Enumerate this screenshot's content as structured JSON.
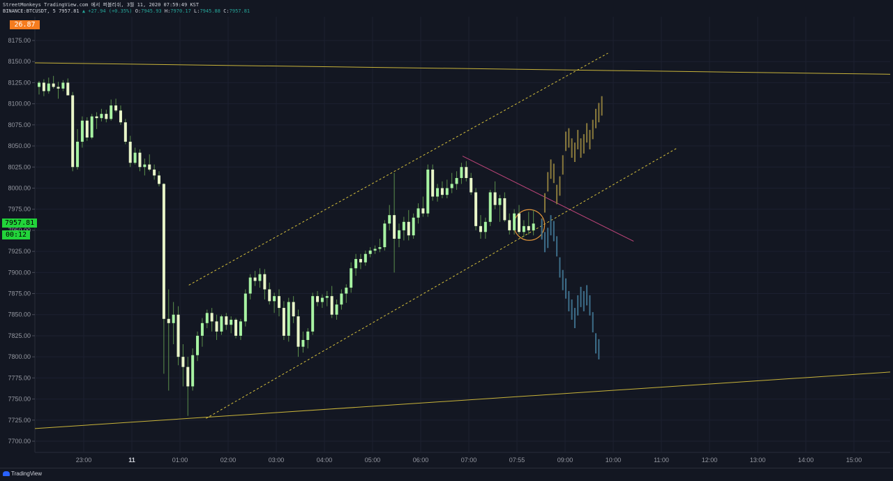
{
  "header": {
    "line1": "StreetMonkeys TradingView.com 에서 퍼블리쉬, 3월 11, 2020 07:59:49 KST",
    "symbol": "BINANCE:BTCUSDT, 5",
    "last": "7957.81",
    "change": "▲ +27.94 (+0.35%)",
    "o_label": "O:",
    "o": "7945.93",
    "h_label": "H:",
    "h": "7970.17",
    "l_label": "L:",
    "l": "7945.88",
    "c_label": "C:",
    "c": "7957.81"
  },
  "indicator_badge": "26.87",
  "price_badge": "7957.81",
  "countdown_badge": "00:12",
  "footer": {
    "brand": "TradingView"
  },
  "colors": {
    "bg": "#131722",
    "up": "#a7f3a2",
    "down": "#e8f5c8",
    "wick": "#5b8f4c",
    "trend": "#c9b43a",
    "channel": "#d8c23c",
    "pink": "#c0457a",
    "circle": "#e0953a",
    "proj_up": "#8a7a3c",
    "proj_down": "#3d6e8a",
    "badge_orange": "#f57c1f",
    "badge_green": "#22d43a"
  },
  "chart_data": {
    "type": "candlestick",
    "interval": "5",
    "ylim": [
      7700,
      8175
    ],
    "y_ticks": [
      "8175.00",
      "8150.00",
      "8125.00",
      "8100.00",
      "8075.00",
      "8050.00",
      "8025.00",
      "8000.00",
      "7975.00",
      "7950.00",
      "7925.00",
      "7900.00",
      "7875.00",
      "7850.00",
      "7825.00",
      "7800.00",
      "7775.00",
      "7750.00",
      "7725.00",
      "7700.00"
    ],
    "x_ticks": [
      "23:00",
      "11",
      "01:00",
      "02:00",
      "03:00",
      "04:00",
      "05:00",
      "06:00",
      "07:00",
      "07:55",
      "09:00",
      "10:00",
      "11:00",
      "12:00",
      "13:00",
      "14:00",
      "15:00"
    ],
    "candles": [
      {
        "o": 8120,
        "h": 8127,
        "l": 8111,
        "c": 8125
      },
      {
        "o": 8125,
        "h": 8129,
        "l": 8109,
        "c": 8115
      },
      {
        "o": 8115,
        "h": 8131,
        "l": 8112,
        "c": 8124
      },
      {
        "o": 8124,
        "h": 8133,
        "l": 8118,
        "c": 8120
      },
      {
        "o": 8120,
        "h": 8126,
        "l": 8106,
        "c": 8118
      },
      {
        "o": 8118,
        "h": 8128,
        "l": 8115,
        "c": 8125
      },
      {
        "o": 8125,
        "h": 8130,
        "l": 8112,
        "c": 8110
      },
      {
        "o": 8110,
        "h": 8114,
        "l": 8020,
        "c": 8025
      },
      {
        "o": 8025,
        "h": 8070,
        "l": 8022,
        "c": 8055
      },
      {
        "o": 8055,
        "h": 8085,
        "l": 8048,
        "c": 8080
      },
      {
        "o": 8080,
        "h": 8084,
        "l": 8056,
        "c": 8060
      },
      {
        "o": 8060,
        "h": 8088,
        "l": 8058,
        "c": 8085
      },
      {
        "o": 8085,
        "h": 8090,
        "l": 8070,
        "c": 8083
      },
      {
        "o": 8083,
        "h": 8094,
        "l": 8079,
        "c": 8088
      },
      {
        "o": 8088,
        "h": 8093,
        "l": 8078,
        "c": 8082
      },
      {
        "o": 8082,
        "h": 8105,
        "l": 8080,
        "c": 8098
      },
      {
        "o": 8098,
        "h": 8106,
        "l": 8090,
        "c": 8092
      },
      {
        "o": 8092,
        "h": 8098,
        "l": 8075,
        "c": 8078
      },
      {
        "o": 8078,
        "h": 8082,
        "l": 8052,
        "c": 8055
      },
      {
        "o": 8055,
        "h": 8062,
        "l": 8025,
        "c": 8030
      },
      {
        "o": 8030,
        "h": 8048,
        "l": 8028,
        "c": 8042
      },
      {
        "o": 8042,
        "h": 8046,
        "l": 8020,
        "c": 8025
      },
      {
        "o": 8025,
        "h": 8035,
        "l": 8015,
        "c": 8028
      },
      {
        "o": 8028,
        "h": 8040,
        "l": 8020,
        "c": 8022
      },
      {
        "o": 8022,
        "h": 8028,
        "l": 8010,
        "c": 8015
      },
      {
        "o": 8015,
        "h": 8020,
        "l": 8002,
        "c": 8005
      },
      {
        "o": 8005,
        "h": 8006,
        "l": 7780,
        "c": 7845
      },
      {
        "o": 7845,
        "h": 7880,
        "l": 7760,
        "c": 7840
      },
      {
        "o": 7840,
        "h": 7865,
        "l": 7815,
        "c": 7850
      },
      {
        "o": 7850,
        "h": 7860,
        "l": 7790,
        "c": 7800
      },
      {
        "o": 7800,
        "h": 7815,
        "l": 7765,
        "c": 7788
      },
      {
        "o": 7788,
        "h": 7800,
        "l": 7730,
        "c": 7765
      },
      {
        "o": 7765,
        "h": 7810,
        "l": 7760,
        "c": 7802
      },
      {
        "o": 7802,
        "h": 7830,
        "l": 7795,
        "c": 7825
      },
      {
        "o": 7825,
        "h": 7846,
        "l": 7812,
        "c": 7840
      },
      {
        "o": 7840,
        "h": 7856,
        "l": 7834,
        "c": 7852
      },
      {
        "o": 7852,
        "h": 7858,
        "l": 7830,
        "c": 7842
      },
      {
        "o": 7842,
        "h": 7850,
        "l": 7820,
        "c": 7830
      },
      {
        "o": 7830,
        "h": 7850,
        "l": 7826,
        "c": 7848
      },
      {
        "o": 7848,
        "h": 7852,
        "l": 7832,
        "c": 7838
      },
      {
        "o": 7838,
        "h": 7848,
        "l": 7828,
        "c": 7844
      },
      {
        "o": 7844,
        "h": 7846,
        "l": 7822,
        "c": 7825
      },
      {
        "o": 7825,
        "h": 7845,
        "l": 7820,
        "c": 7842
      },
      {
        "o": 7842,
        "h": 7880,
        "l": 7836,
        "c": 7875
      },
      {
        "o": 7875,
        "h": 7898,
        "l": 7868,
        "c": 7894
      },
      {
        "o": 7894,
        "h": 7902,
        "l": 7884,
        "c": 7890
      },
      {
        "o": 7890,
        "h": 7905,
        "l": 7882,
        "c": 7898
      },
      {
        "o": 7898,
        "h": 7904,
        "l": 7868,
        "c": 7880
      },
      {
        "o": 7880,
        "h": 7888,
        "l": 7862,
        "c": 7866
      },
      {
        "o": 7866,
        "h": 7876,
        "l": 7852,
        "c": 7872
      },
      {
        "o": 7872,
        "h": 7880,
        "l": 7848,
        "c": 7858
      },
      {
        "o": 7858,
        "h": 7866,
        "l": 7820,
        "c": 7825
      },
      {
        "o": 7825,
        "h": 7870,
        "l": 7818,
        "c": 7865
      },
      {
        "o": 7865,
        "h": 7872,
        "l": 7840,
        "c": 7848
      },
      {
        "o": 7848,
        "h": 7856,
        "l": 7800,
        "c": 7812
      },
      {
        "o": 7812,
        "h": 7830,
        "l": 7805,
        "c": 7820
      },
      {
        "o": 7820,
        "h": 7834,
        "l": 7810,
        "c": 7830
      },
      {
        "o": 7830,
        "h": 7876,
        "l": 7826,
        "c": 7872
      },
      {
        "o": 7872,
        "h": 7878,
        "l": 7860,
        "c": 7865
      },
      {
        "o": 7865,
        "h": 7874,
        "l": 7858,
        "c": 7870
      },
      {
        "o": 7870,
        "h": 7878,
        "l": 7860,
        "c": 7872
      },
      {
        "o": 7872,
        "h": 7884,
        "l": 7846,
        "c": 7850
      },
      {
        "o": 7850,
        "h": 7868,
        "l": 7844,
        "c": 7862
      },
      {
        "o": 7862,
        "h": 7880,
        "l": 7856,
        "c": 7875
      },
      {
        "o": 7875,
        "h": 7886,
        "l": 7864,
        "c": 7882
      },
      {
        "o": 7882,
        "h": 7912,
        "l": 7876,
        "c": 7905
      },
      {
        "o": 7905,
        "h": 7922,
        "l": 7896,
        "c": 7916
      },
      {
        "o": 7916,
        "h": 7922,
        "l": 7904,
        "c": 7912
      },
      {
        "o": 7912,
        "h": 7926,
        "l": 7908,
        "c": 7922
      },
      {
        "o": 7922,
        "h": 7930,
        "l": 7918,
        "c": 7926
      },
      {
        "o": 7926,
        "h": 7932,
        "l": 7922,
        "c": 7928
      },
      {
        "o": 7928,
        "h": 7940,
        "l": 7924,
        "c": 7930
      },
      {
        "o": 7930,
        "h": 7962,
        "l": 7926,
        "c": 7958
      },
      {
        "o": 7958,
        "h": 7980,
        "l": 7950,
        "c": 7968
      },
      {
        "o": 7968,
        "h": 8018,
        "l": 7900,
        "c": 7940
      },
      {
        "o": 7940,
        "h": 7958,
        "l": 7930,
        "c": 7950
      },
      {
        "o": 7950,
        "h": 7966,
        "l": 7938,
        "c": 7960
      },
      {
        "o": 7960,
        "h": 7974,
        "l": 7938,
        "c": 7944
      },
      {
        "o": 7944,
        "h": 7970,
        "l": 7940,
        "c": 7965
      },
      {
        "o": 7965,
        "h": 7982,
        "l": 7958,
        "c": 7976
      },
      {
        "o": 7976,
        "h": 7990,
        "l": 7966,
        "c": 7970
      },
      {
        "o": 7970,
        "h": 8028,
        "l": 7966,
        "c": 8022
      },
      {
        "o": 8022,
        "h": 8028,
        "l": 7985,
        "c": 7990
      },
      {
        "o": 7990,
        "h": 8005,
        "l": 7984,
        "c": 8000
      },
      {
        "o": 8000,
        "h": 8008,
        "l": 7988,
        "c": 7992
      },
      {
        "o": 7992,
        "h": 8010,
        "l": 7988,
        "c": 8000
      },
      {
        "o": 8000,
        "h": 8018,
        "l": 7994,
        "c": 8005
      },
      {
        "o": 8005,
        "h": 8020,
        "l": 7998,
        "c": 8012
      },
      {
        "o": 8012,
        "h": 8030,
        "l": 8005,
        "c": 8025
      },
      {
        "o": 8025,
        "h": 8032,
        "l": 8008,
        "c": 8012
      },
      {
        "o": 8012,
        "h": 8018,
        "l": 7992,
        "c": 7995
      },
      {
        "o": 7995,
        "h": 8000,
        "l": 7950,
        "c": 7955
      },
      {
        "o": 7955,
        "h": 7968,
        "l": 7940,
        "c": 7948
      },
      {
        "o": 7948,
        "h": 7965,
        "l": 7940,
        "c": 7960
      },
      {
        "o": 7960,
        "h": 7998,
        "l": 7955,
        "c": 7995
      },
      {
        "o": 7995,
        "h": 8008,
        "l": 7975,
        "c": 7980
      },
      {
        "o": 7980,
        "h": 7992,
        "l": 7960,
        "c": 7988
      },
      {
        "o": 7988,
        "h": 7995,
        "l": 7960,
        "c": 7962
      },
      {
        "o": 7962,
        "h": 7970,
        "l": 7945,
        "c": 7950
      },
      {
        "o": 7950,
        "h": 7975,
        "l": 7945,
        "c": 7970
      },
      {
        "o": 7970,
        "h": 7980,
        "l": 7945,
        "c": 7948
      },
      {
        "o": 7948,
        "h": 7962,
        "l": 7942,
        "c": 7955
      },
      {
        "o": 7955,
        "h": 7972,
        "l": 7945,
        "c": 7950
      },
      {
        "o": 7950,
        "h": 7974,
        "l": 7944,
        "c": 7958
      }
    ],
    "projection_up": [
      7955,
      7985,
      8010,
      8025,
      8020,
      7995,
      8005,
      8030,
      8058,
      8062,
      8050,
      8045,
      8060,
      8050,
      8055,
      8068,
      8060,
      8072,
      8085,
      8092,
      8100
    ],
    "projection_down": [
      7950,
      7935,
      7940,
      7955,
      7948,
      7930,
      7905,
      7890,
      7880,
      7865,
      7855,
      7845,
      7860,
      7870,
      7865,
      7872,
      7860,
      7840,
      7815,
      7808
    ],
    "drawings": {
      "upper_trendline": [
        [
          8148.5,
          0
        ],
        [
          8135,
          1
        ]
      ],
      "lower_trendline": [
        [
          7715,
          0
        ],
        [
          7782,
          1
        ]
      ],
      "channel_upper": [
        [
          7885,
          0.18
        ],
        [
          8160,
          0.67
        ]
      ],
      "channel_lower": [
        [
          7727,
          0.2
        ],
        [
          8047,
          0.75
        ]
      ],
      "pink_line": [
        [
          8038,
          0.5
        ],
        [
          7937,
          0.7
        ]
      ]
    }
  }
}
